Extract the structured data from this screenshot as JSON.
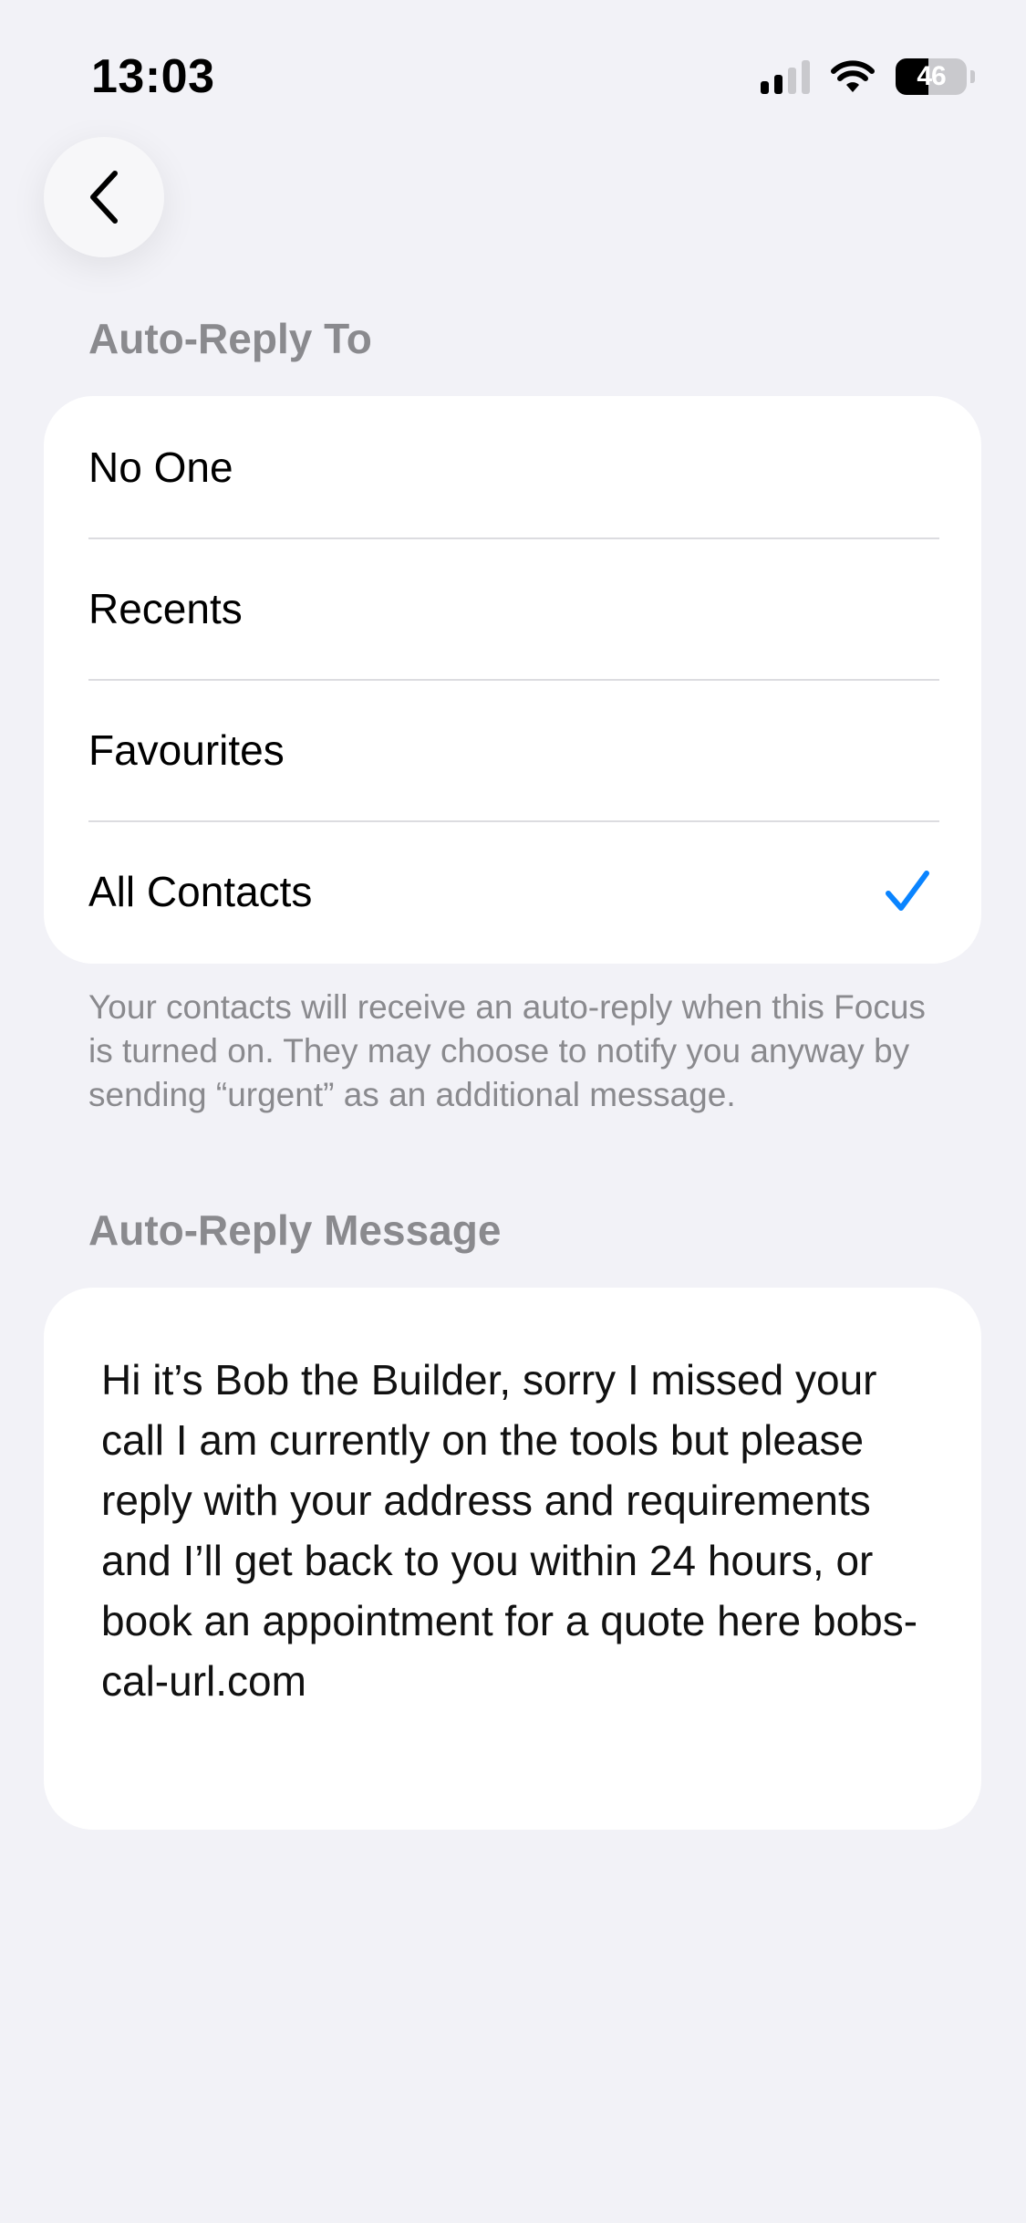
{
  "status_bar": {
    "time": "13:03",
    "battery_level": "46",
    "battery_fraction": 0.46
  },
  "icons": {
    "back": "chevron-left-icon",
    "signal": "cellular-signal-icon",
    "wifi": "wifi-icon",
    "battery": "battery-icon",
    "check": "checkmark-icon"
  },
  "colors": {
    "background": "#f2f2f7",
    "accent": "#0a84ff",
    "secondary_text": "#8a8a8e"
  },
  "auto_reply_to": {
    "header": "Auto-Reply To",
    "options": [
      {
        "label": "No One",
        "selected": false
      },
      {
        "label": "Recents",
        "selected": false
      },
      {
        "label": "Favourites",
        "selected": false
      },
      {
        "label": "All Contacts",
        "selected": true
      }
    ],
    "footer": "Your contacts will receive an auto-reply when this Focus is turned on. They may choose to notify you anyway by sending “urgent” as an additional message."
  },
  "auto_reply_message": {
    "header": "Auto-Reply Message",
    "text": "Hi it’s Bob the Builder, sorry I missed your call I am currently on the tools but please reply with your address and requirements and I’ll get back to you within 24 hours, or book an appointment for a quote here bobs-cal-url.com"
  }
}
